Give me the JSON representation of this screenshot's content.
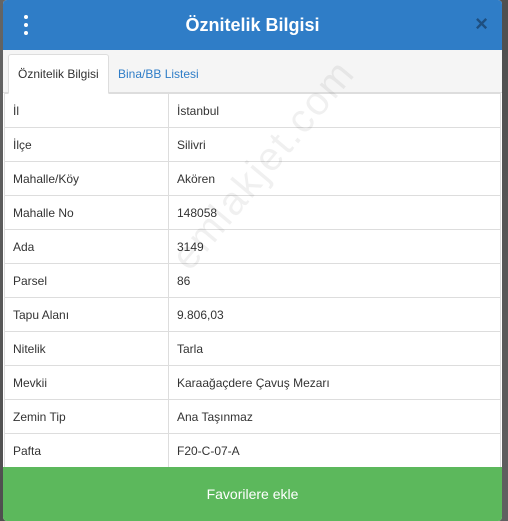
{
  "modal": {
    "title": "Öznitelik Bilgisi",
    "close_symbol": "×"
  },
  "tabs": [
    {
      "label": "Öznitelik Bilgisi",
      "active": true
    },
    {
      "label": "Bina/BB Listesi",
      "active": false
    }
  ],
  "rows": [
    {
      "label": "İl",
      "value": "İstanbul"
    },
    {
      "label": "İlçe",
      "value": "Silivri"
    },
    {
      "label": "Mahalle/Köy",
      "value": "Akören"
    },
    {
      "label": "Mahalle No",
      "value": "148058"
    },
    {
      "label": "Ada",
      "value": "3149"
    },
    {
      "label": "Parsel",
      "value": "86"
    },
    {
      "label": "Tapu Alanı",
      "value": "9.806,03"
    },
    {
      "label": "Nitelik",
      "value": "Tarla"
    },
    {
      "label": "Mevkii",
      "value": "Karaağaçdere Çavuş Mezarı"
    },
    {
      "label": "Zemin Tip",
      "value": "Ana Taşınmaz"
    },
    {
      "label": "Pafta",
      "value": "F20-C-07-A"
    }
  ],
  "favorite_button": "Favorilere ekle",
  "watermark": "emlakjet.com",
  "icons": {
    "menu": "vertical-dots-icon",
    "close": "close-icon"
  },
  "colors": {
    "header": "#2f7dc7",
    "button": "#5cb85c",
    "tab_link": "#2f7dc7"
  }
}
